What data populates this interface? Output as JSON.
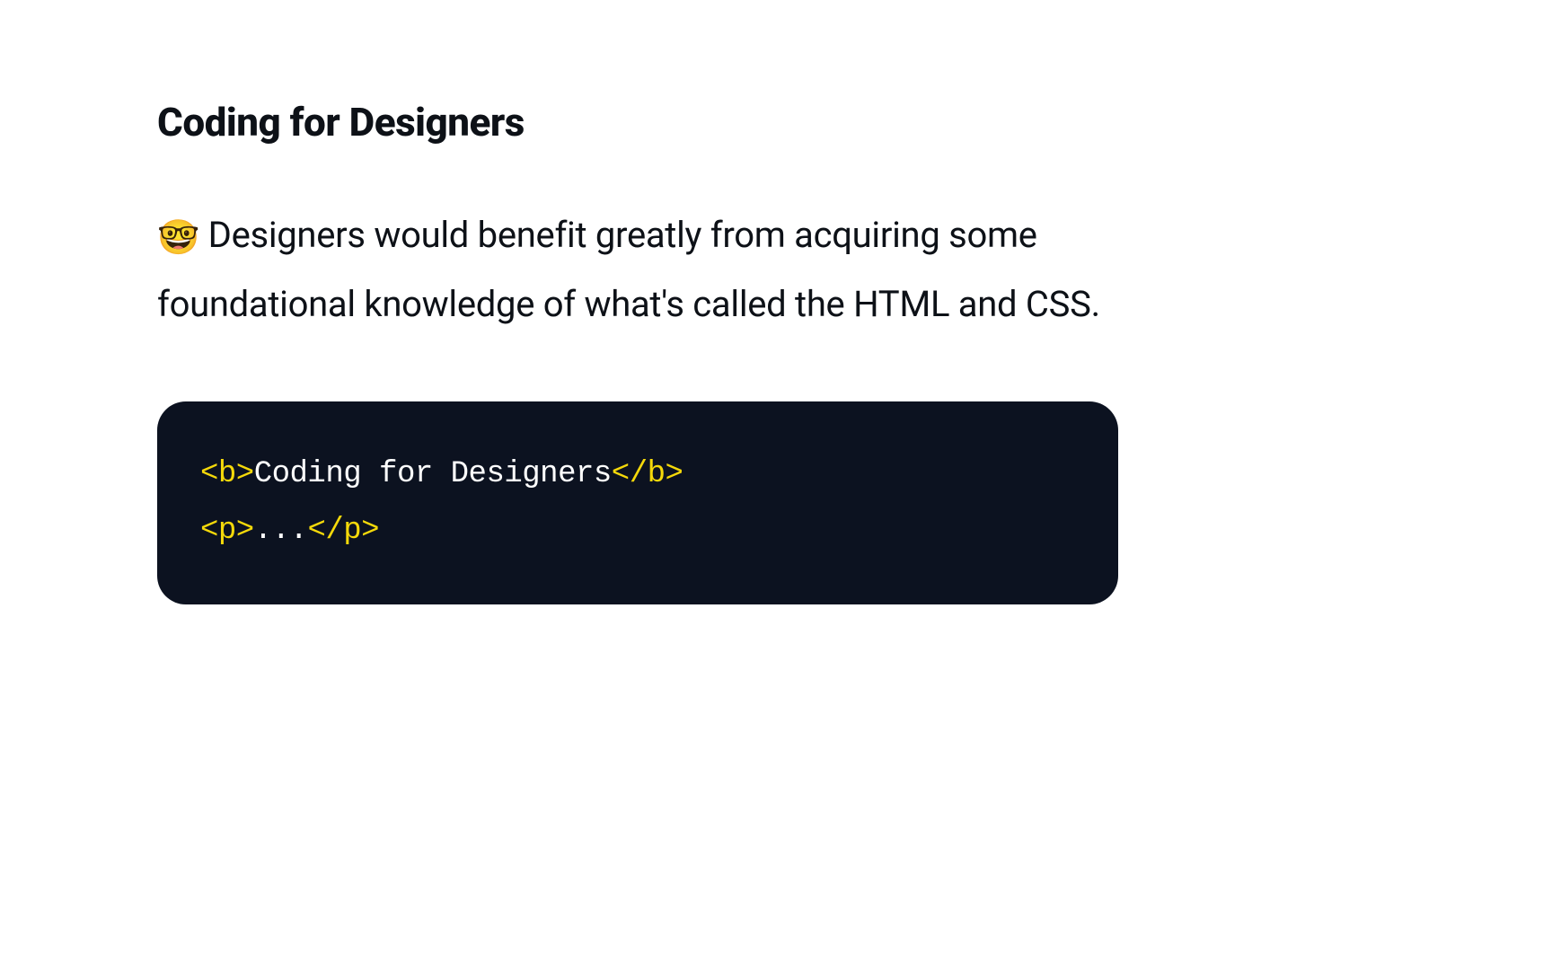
{
  "article": {
    "heading": "Coding for Designers",
    "emoji": "🤓",
    "paragraph_text": " Designers would benefit greatly from acquiring some foundational knowledge of what's called the HTML and CSS."
  },
  "code": {
    "line1": {
      "open_tag": "<b>",
      "content": "Coding for Designers",
      "close_tag": "</b>"
    },
    "line2": {
      "open_tag": "<p>",
      "content": "...",
      "close_tag": "</p>"
    }
  },
  "colors": {
    "background": "#ffffff",
    "text": "#0d1117",
    "code_bg": "#0c1220",
    "code_tag": "#f5d90a",
    "code_text": "#ffffff"
  }
}
